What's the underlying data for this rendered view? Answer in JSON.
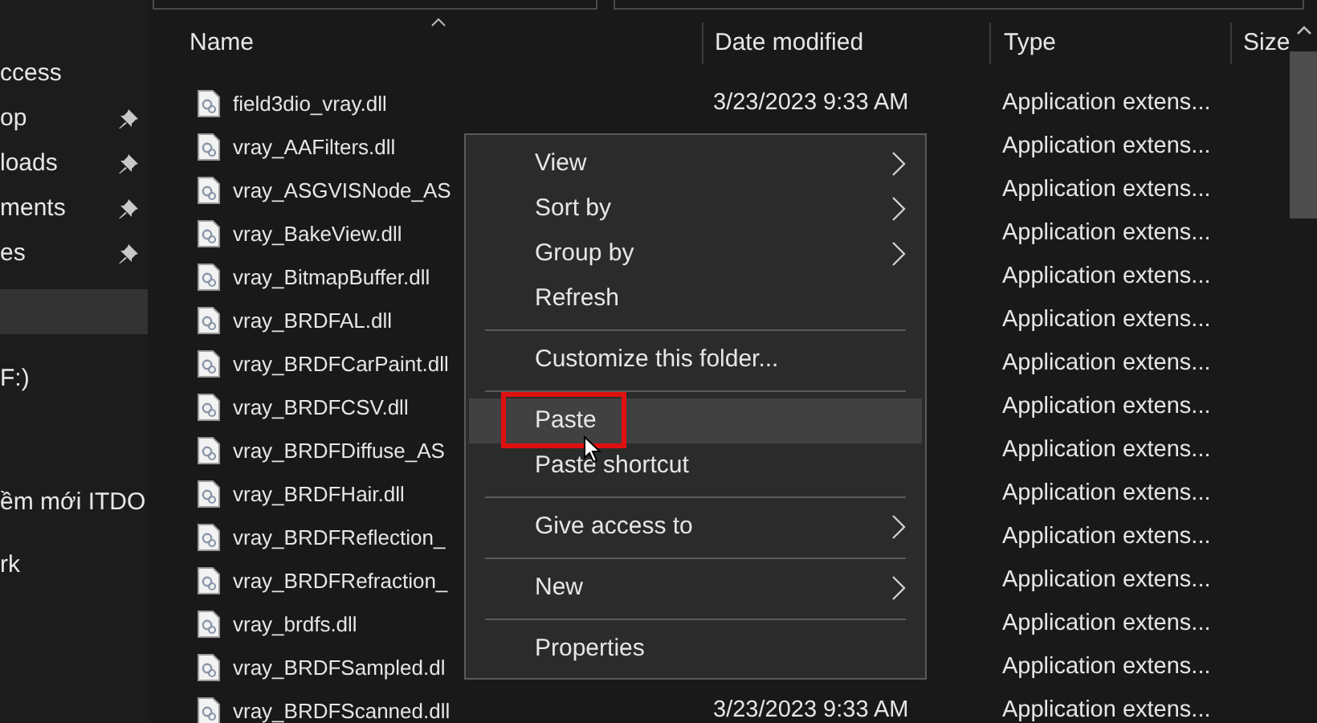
{
  "sidebar": {
    "items": [
      {
        "label": "ccess",
        "pinned": false,
        "selected": false
      },
      {
        "label": "op",
        "pinned": true,
        "selected": false
      },
      {
        "label": "loads",
        "pinned": true,
        "selected": false
      },
      {
        "label": "ments",
        "pinned": true,
        "selected": false
      },
      {
        "label": "es",
        "pinned": true,
        "selected": false
      },
      {
        "pinned": false,
        "selected": true
      },
      {
        "label": "F:)",
        "pinned": false,
        "selected": false
      },
      {
        "label": "ềm mới ITDO",
        "pinned": false,
        "selected": false
      },
      {
        "label": "rk",
        "pinned": false,
        "selected": false
      }
    ]
  },
  "table": {
    "columns": [
      "Name",
      "Date modified",
      "Type",
      "Size"
    ],
    "rows": [
      {
        "name": "field3dio_vray.dll",
        "date": "3/23/2023 9:33 AM",
        "type": "Application extens..."
      },
      {
        "name": "vray_AAFilters.dll",
        "type": "Application extens..."
      },
      {
        "name": "vray_ASGVISNode_AS",
        "type": "Application extens..."
      },
      {
        "name": "vray_BakeView.dll",
        "type": "Application extens..."
      },
      {
        "name": "vray_BitmapBuffer.dll",
        "type": "Application extens..."
      },
      {
        "name": "vray_BRDFAL.dll",
        "type": "Application extens..."
      },
      {
        "name": "vray_BRDFCarPaint.dll",
        "type": "Application extens..."
      },
      {
        "name": "vray_BRDFCSV.dll",
        "type": "Application extens..."
      },
      {
        "name": "vray_BRDFDiffuse_AS",
        "type": "Application extens..."
      },
      {
        "name": "vray_BRDFHair.dll",
        "type": "Application extens..."
      },
      {
        "name": "vray_BRDFReflection_",
        "type": "Application extens..."
      },
      {
        "name": "vray_BRDFRefraction_",
        "type": "Application extens..."
      },
      {
        "name": "vray_brdfs.dll",
        "type": "Application extens..."
      },
      {
        "name": "vray_BRDFSampled.dl",
        "type": "Application extens..."
      },
      {
        "name": "vray_BRDFScanned.dll",
        "date": "3/23/2023 9:33 AM",
        "type": "Application extens..."
      }
    ]
  },
  "context_menu": {
    "items": [
      {
        "kind": "item",
        "label": "View",
        "submenu": true,
        "selected": false
      },
      {
        "kind": "item",
        "label": "Sort by",
        "submenu": true,
        "selected": false
      },
      {
        "kind": "item",
        "label": "Group by",
        "submenu": true,
        "selected": false
      },
      {
        "kind": "item",
        "label": "Refresh",
        "submenu": false,
        "selected": false
      },
      {
        "kind": "separator"
      },
      {
        "kind": "item",
        "label": "Customize this folder...",
        "submenu": false,
        "selected": false
      },
      {
        "kind": "separator"
      },
      {
        "kind": "item",
        "label": "Paste",
        "submenu": false,
        "selected": true,
        "outlined": true
      },
      {
        "kind": "item",
        "label": "Paste shortcut",
        "submenu": false,
        "selected": false
      },
      {
        "kind": "separator"
      },
      {
        "kind": "item",
        "label": "Give access to",
        "submenu": true,
        "selected": false
      },
      {
        "kind": "separator"
      },
      {
        "kind": "item",
        "label": "New",
        "submenu": true,
        "selected": false
      },
      {
        "kind": "separator"
      },
      {
        "kind": "item",
        "label": "Properties",
        "submenu": false,
        "selected": false
      }
    ]
  }
}
